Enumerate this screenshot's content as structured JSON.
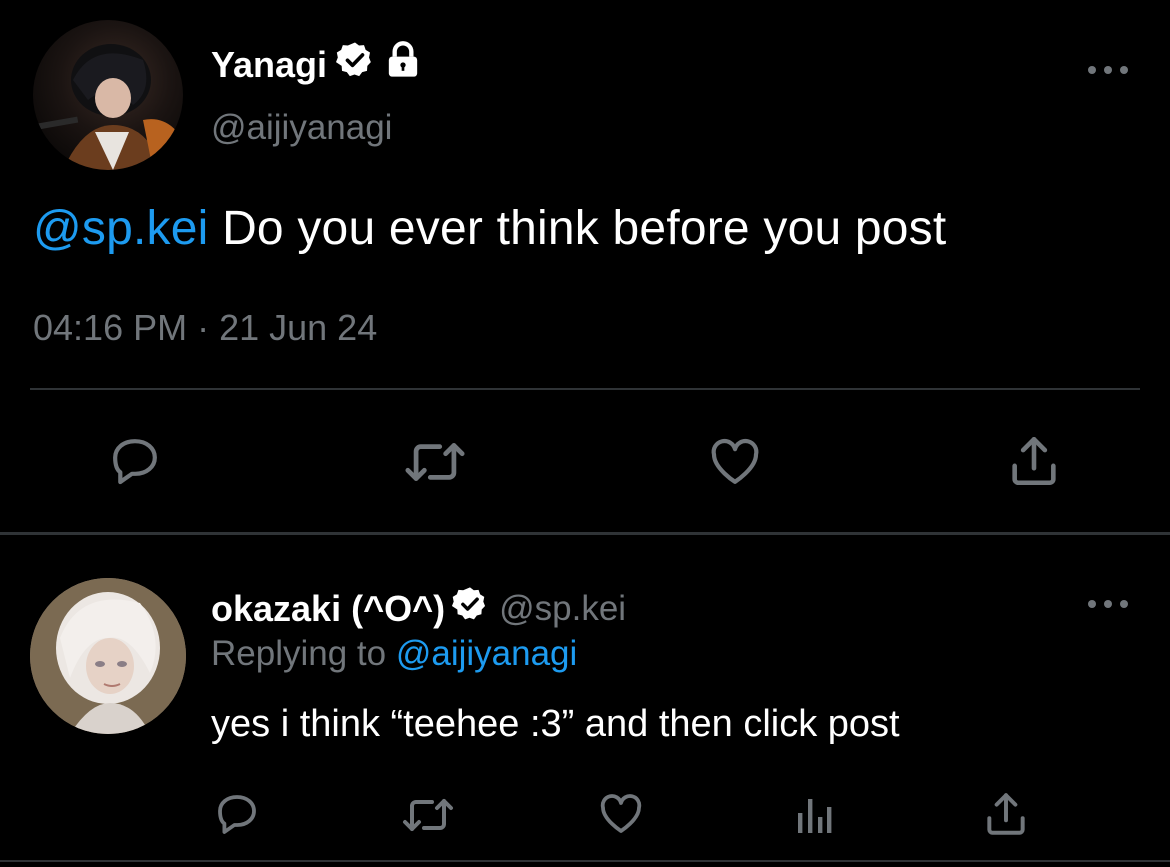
{
  "main_tweet": {
    "author_name": "Yanagi",
    "author_handle": "@aijiyanagi",
    "mention": "@sp.kei",
    "text": " Do you ever think before you post",
    "timestamp": "04:16 PM · 21 Jun 24",
    "icons": {
      "verified": "verified-badge-icon",
      "protected": "lock-icon",
      "more": "more-options-icon",
      "reply": "reply-icon",
      "retweet": "retweet-icon",
      "like": "like-icon",
      "share": "share-icon"
    }
  },
  "reply_tweet": {
    "author_name": "okazaki (^O^)",
    "author_handle": "@sp.kei",
    "replying_prefix": "Replying to ",
    "replying_handle": "@aijiyanagi",
    "text": "yes i think “teehee :3” and then click post",
    "icons": {
      "verified": "verified-badge-icon",
      "more": "more-options-icon",
      "reply": "reply-icon",
      "retweet": "retweet-icon",
      "like": "like-icon",
      "views": "analytics-icon",
      "share": "share-icon"
    }
  },
  "colors": {
    "background": "#000000",
    "primary_text": "#ffffff",
    "secondary_text": "#71767b",
    "accent": "#1d9bf0",
    "divider": "#2f3336"
  }
}
